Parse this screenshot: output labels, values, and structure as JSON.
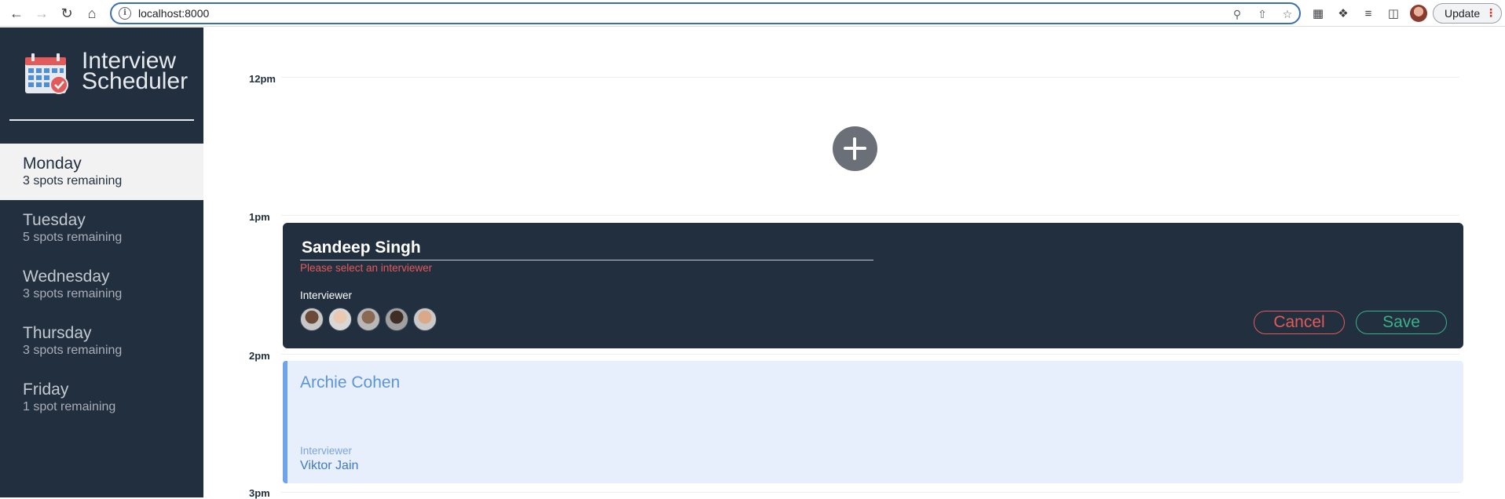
{
  "browser": {
    "url": "localhost:8000",
    "update_label": "Update"
  },
  "sidebar": {
    "title_line1": "Interview",
    "title_line2": "Scheduler",
    "days": [
      {
        "name": "Monday",
        "spots": "3 spots remaining",
        "selected": true
      },
      {
        "name": "Tuesday",
        "spots": "5 spots remaining",
        "selected": false
      },
      {
        "name": "Wednesday",
        "spots": "3 spots remaining",
        "selected": false
      },
      {
        "name": "Thursday",
        "spots": "3 spots remaining",
        "selected": false
      },
      {
        "name": "Friday",
        "spots": "1 spot remaining",
        "selected": false
      }
    ]
  },
  "schedule": {
    "times": [
      "12pm",
      "1pm",
      "2pm",
      "3pm"
    ],
    "form": {
      "student_value": "Sandeep Singh",
      "error": "Please select an interviewer",
      "interviewer_heading": "Interviewer",
      "cancel_label": "Cancel",
      "save_label": "Save"
    },
    "appointment": {
      "student": "Archie Cohen",
      "interviewer_label": "Interviewer",
      "interviewer_name": "Viktor Jain"
    }
  },
  "colors": {
    "sidebar_bg": "#222f3e",
    "danger": "#e25a5a",
    "success": "#3bb08a",
    "appointment_accent": "#6fa3ec"
  }
}
